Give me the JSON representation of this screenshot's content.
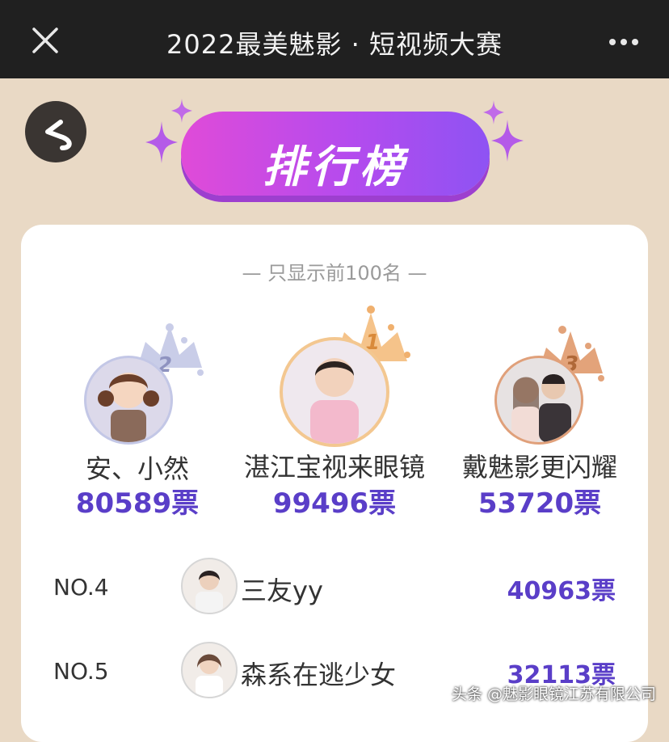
{
  "header": {
    "title": "2022最美魅影 · 短视频大赛",
    "close_icon": "close-icon",
    "more_icon": "more-icon"
  },
  "back_button": {
    "icon": "back-arrow-icon"
  },
  "banner": {
    "label": "排行榜"
  },
  "ranking": {
    "subtitle": "— 只显示前100名 —",
    "podium": [
      {
        "rank": "2",
        "name": "安、小然",
        "votes": "80589票"
      },
      {
        "rank": "1",
        "name": "湛江宝视来眼镜",
        "votes": "99496票"
      },
      {
        "rank": "3",
        "name": "戴魅影更闪耀",
        "votes": "53720票"
      }
    ],
    "list": [
      {
        "no": "NO.4",
        "name": "三友yy",
        "votes": "40963票"
      },
      {
        "no": "NO.5",
        "name": "森系在逃少女",
        "votes": "32113票"
      }
    ]
  },
  "colors": {
    "accent": "#5a3ec8",
    "banner_pink": "#e04bd8",
    "banner_purple": "#8e53f3",
    "background": "#e9d9c5",
    "topbar": "#202020"
  },
  "watermark": "头条 @魅影眼镜江苏有限公司"
}
